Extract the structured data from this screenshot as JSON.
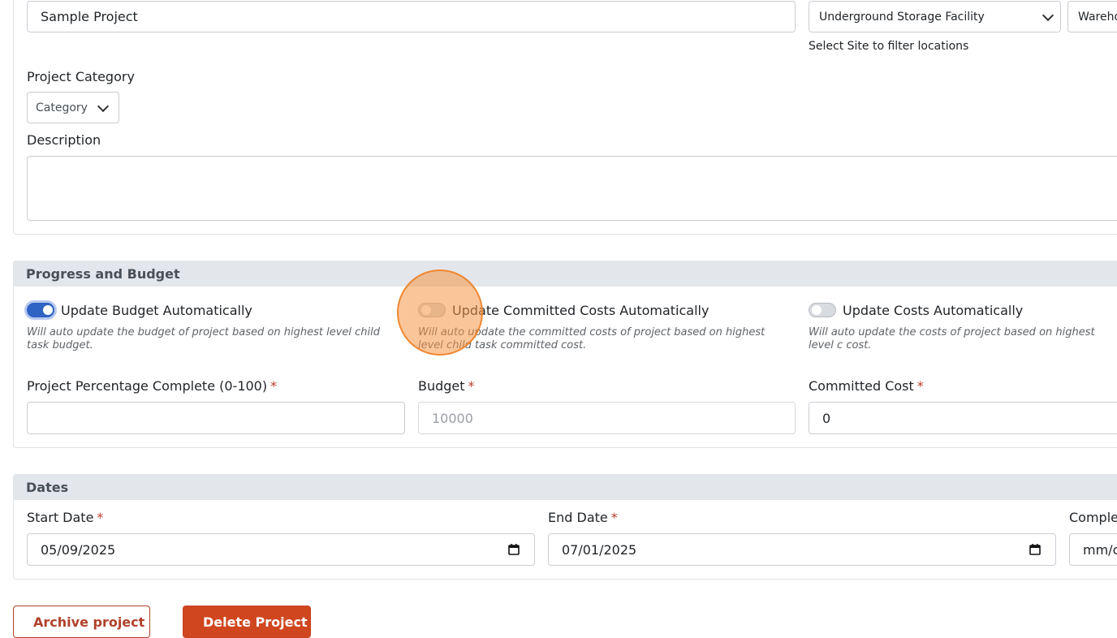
{
  "general": {
    "project_name_value": "Sample Project",
    "site_value": "Underground Storage Facility",
    "location_value": "Wareho",
    "site_help": "Select Site to filter locations",
    "category_label": "Project Category",
    "category_value": "Category",
    "description_label": "Description",
    "description_value": ""
  },
  "progress": {
    "title": "Progress and Budget",
    "toggles": [
      {
        "label": "Update Budget Automatically",
        "on": true,
        "note": "Will auto update the budget of project based on highest level child task budget."
      },
      {
        "label": "Update Committed Costs Automatically",
        "on": false,
        "note": "Will auto update the committed costs of project based on highest level child task committed cost."
      },
      {
        "label": "Update Costs Automatically",
        "on": false,
        "note": "Will auto update the costs of project based on highest level c cost."
      }
    ],
    "percent_label": "Project Percentage Complete (0-100)",
    "percent_value": "",
    "budget_label": "Budget",
    "budget_placeholder": "10000",
    "committed_label": "Committed Cost",
    "committed_value": "0",
    "required_mark": "*"
  },
  "dates": {
    "title": "Dates",
    "start_label": "Start Date",
    "start_value": "05/09/2025",
    "end_label": "End Date",
    "end_value": "07/01/2025",
    "complete_label": "Complet",
    "complete_value": "mm/c"
  },
  "actions": {
    "archive_label": "Archive project",
    "delete_label": "Delete Project"
  },
  "colors": {
    "accent": "#2f63c4",
    "danger": "#d0461f",
    "required": "#c0392b"
  }
}
